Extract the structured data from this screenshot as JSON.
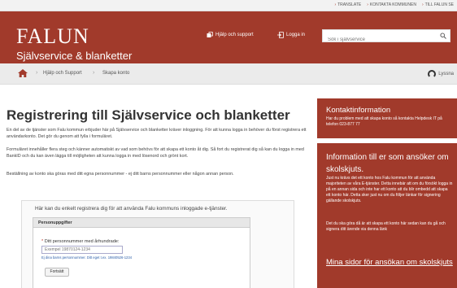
{
  "topbar": {
    "links": [
      "TRANSLATE",
      "KONTAKTA KOMMUNEN",
      "TILL FALUN SE"
    ]
  },
  "header": {
    "logo_text": "FALUN",
    "site_title": "Självservice & blanketter",
    "help_label": "Hjälp och support",
    "login_label": "Logga in",
    "search_placeholder": "Sök i självservice"
  },
  "breadcrumb": {
    "items": [
      "Hjälp och Support",
      "Skapa konto"
    ],
    "listen_label": "Lyssna"
  },
  "main": {
    "title": "Registrering till Självservice och blanketter",
    "paragraphs": [
      "En del av de tjänster som Falu kommun erbjuder här på Självservice och blanketter kräver inloggning. För att kunna logga in behöver du först registrera ett användarkonto. Det gör du genom att fylla i formuläret.",
      "Formuläret innehåller flera steg och känner automatiskt av vad som behövs för att skapa ett konto åt dig. Så fort du registrerat dig så kan du logga in med BankID och du kan även lägga till möjligheten att kunna logga in med lösenord och grönt kort.",
      "Beställning av konto ska göras med ditt egna personnummer - ej ditt barns personnummer eller någon annan person."
    ],
    "form_intro": "Här kan du enkelt registrera dig för att använda Falu kommuns inloggade e-tjänster.",
    "form": {
      "section_title": "Personuppgifter",
      "pnr_label": "Ditt personnummer med århundrade:",
      "required_mark": "*",
      "pnr_placeholder": "Exempel 19870124-1234",
      "hint": "Ej dina barns personnummer. Ditt eget t.ex. 19840526-1234",
      "submit_label": "Fortsätt"
    }
  },
  "sidebar": {
    "contact": {
      "heading": "Kontaktinformation",
      "text": "Har du problem med att skapa konto så kontakta Helpdesk IT på telefon 023-877 77"
    },
    "school": {
      "heading": "Information till er som ansöker om skolskjuts.",
      "text1": "Just nu krävs det ett konto hos Falu kommun för att använda majoriteten av våra E-tjänster. Detta innebär att om du försökt logga in på en annan sida och inte har ett konto att du blir ombedd att skapa ett konto här. Detta sker just nu om du följer länkar för signering gällande skolskjuts.",
      "text2": "Det du ska göra då är att skapa ett konto här sedan kan du gå och signera ditt ärende via denna länk",
      "link": "Mina sidor för ansökan om skolskjuts"
    }
  },
  "colors": {
    "brand": "#a13a2b",
    "topbar_bg": "#f2f2f2",
    "breadcrumb_bg": "#ebebeb"
  }
}
